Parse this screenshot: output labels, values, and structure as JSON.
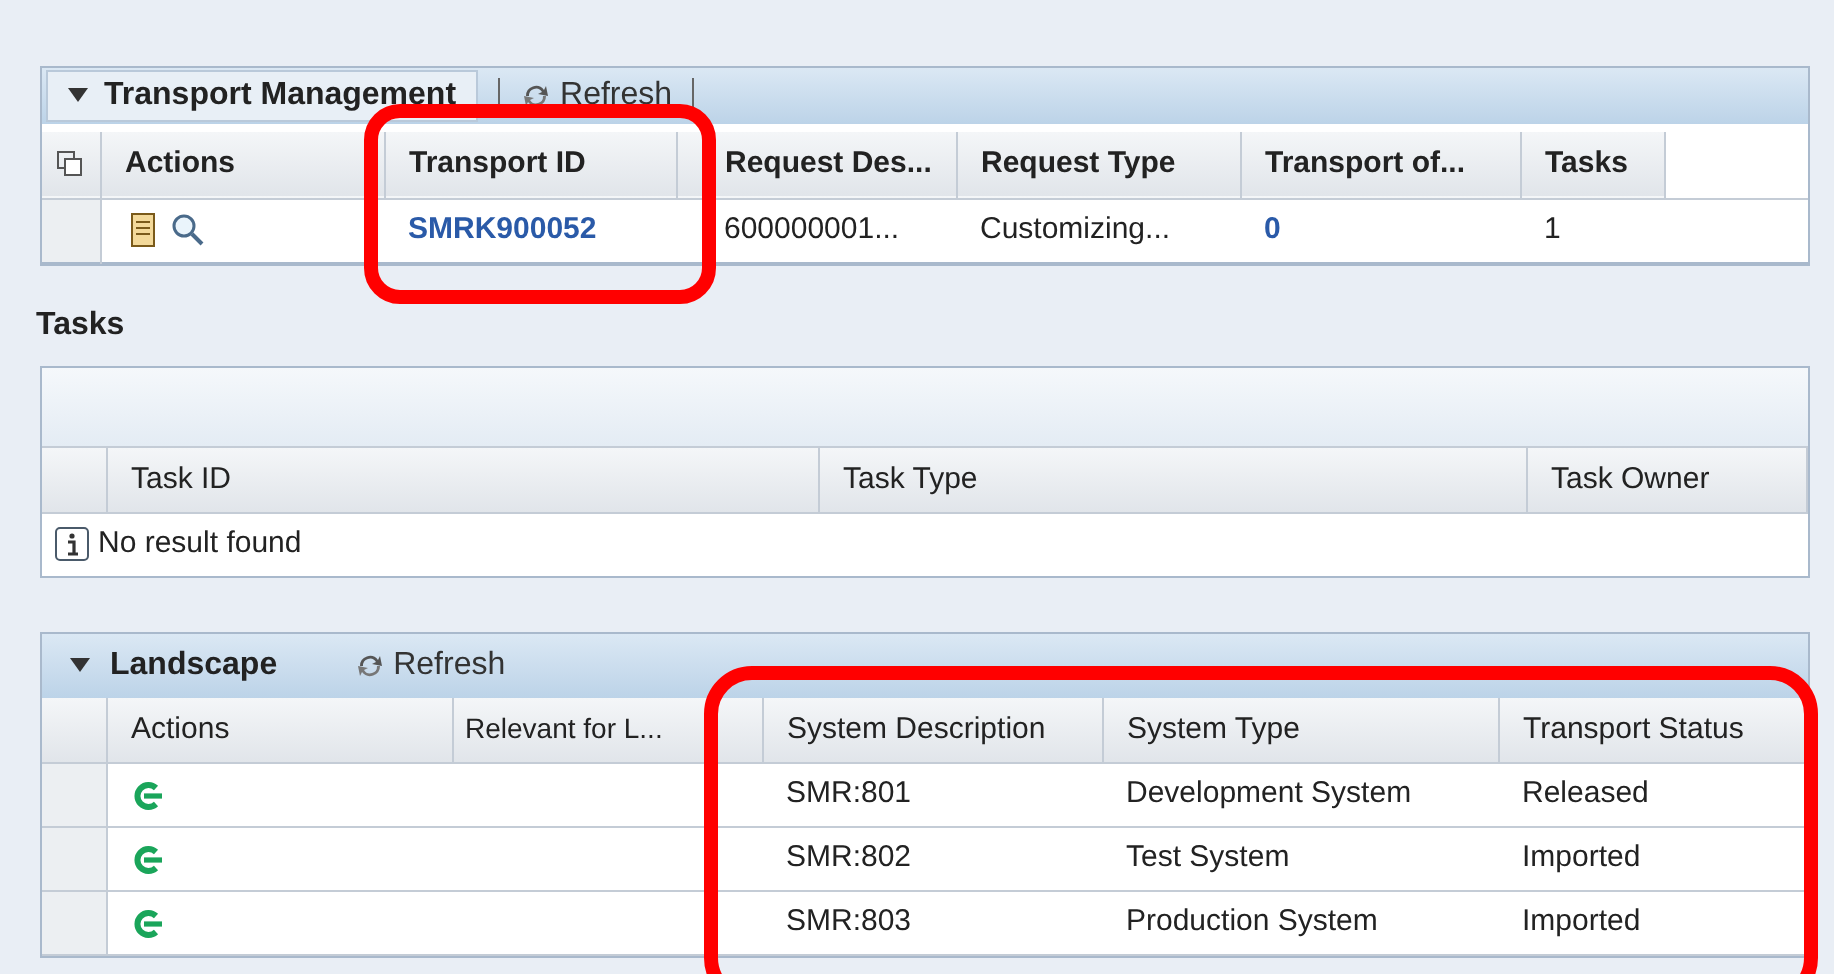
{
  "transport_management": {
    "title": "Transport Management",
    "expanded": true,
    "refresh": "Refresh",
    "columns": [
      "Actions",
      "Transport ID",
      "Request Des...",
      "Request Type",
      "Transport of...",
      "Tasks"
    ],
    "rows": [
      {
        "transport_id": "SMRK900052",
        "request_description": "600000001...",
        "request_type": "Customizing...",
        "transport_of": "0",
        "tasks": "1"
      }
    ]
  },
  "tasks": {
    "title": "Tasks",
    "columns": [
      "Task ID",
      "Task Type",
      "Task Owner"
    ],
    "empty_message": "No result found"
  },
  "landscape": {
    "title": "Landscape",
    "expanded": true,
    "refresh": "Refresh",
    "columns": [
      "Actions",
      "Relevant for L...",
      "System Description",
      "System Type",
      "Transport Status"
    ],
    "rows": [
      {
        "system_description": "SMR:801",
        "system_type": "Development System",
        "transport_status": "Released"
      },
      {
        "system_description": "SMR:802",
        "system_type": "Test System",
        "transport_status": "Imported"
      },
      {
        "system_description": "SMR:803",
        "system_type": "Production System",
        "transport_status": "Imported"
      }
    ]
  }
}
